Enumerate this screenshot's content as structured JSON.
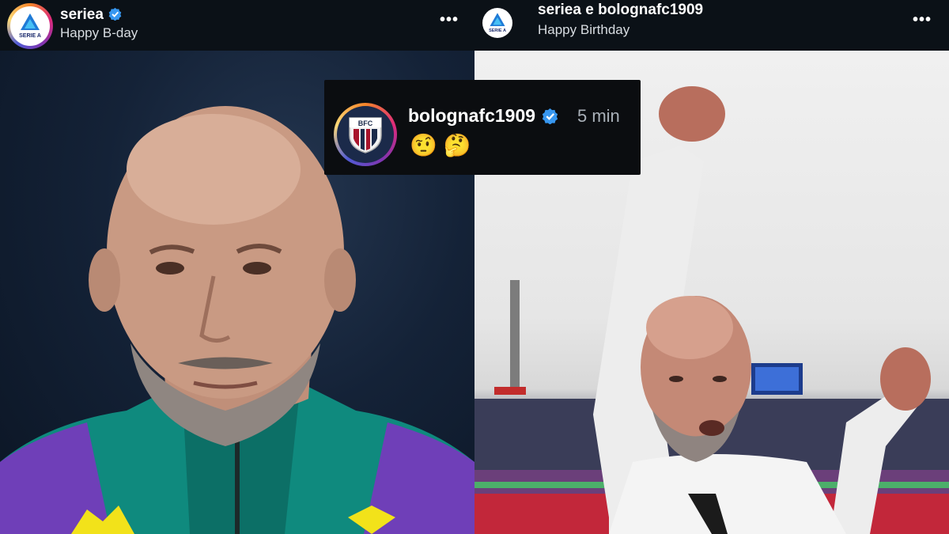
{
  "left_post": {
    "username": "seriea",
    "caption": "Happy B-day",
    "more_label": "•••",
    "logo_text": "SERIE A"
  },
  "right_post": {
    "username": "seriea e bolognafc1909",
    "caption": "Happy Birthday",
    "more_label": "•••",
    "logo_text": "SERIE A"
  },
  "comment": {
    "username": "bolognafc1909",
    "time": "5 min",
    "text": "🤨 🤔",
    "logo_text": "BFC"
  },
  "colors": {
    "header_bg": "#0b1117",
    "verified": "#3797f0",
    "comment_bg": "#0b0d10"
  }
}
